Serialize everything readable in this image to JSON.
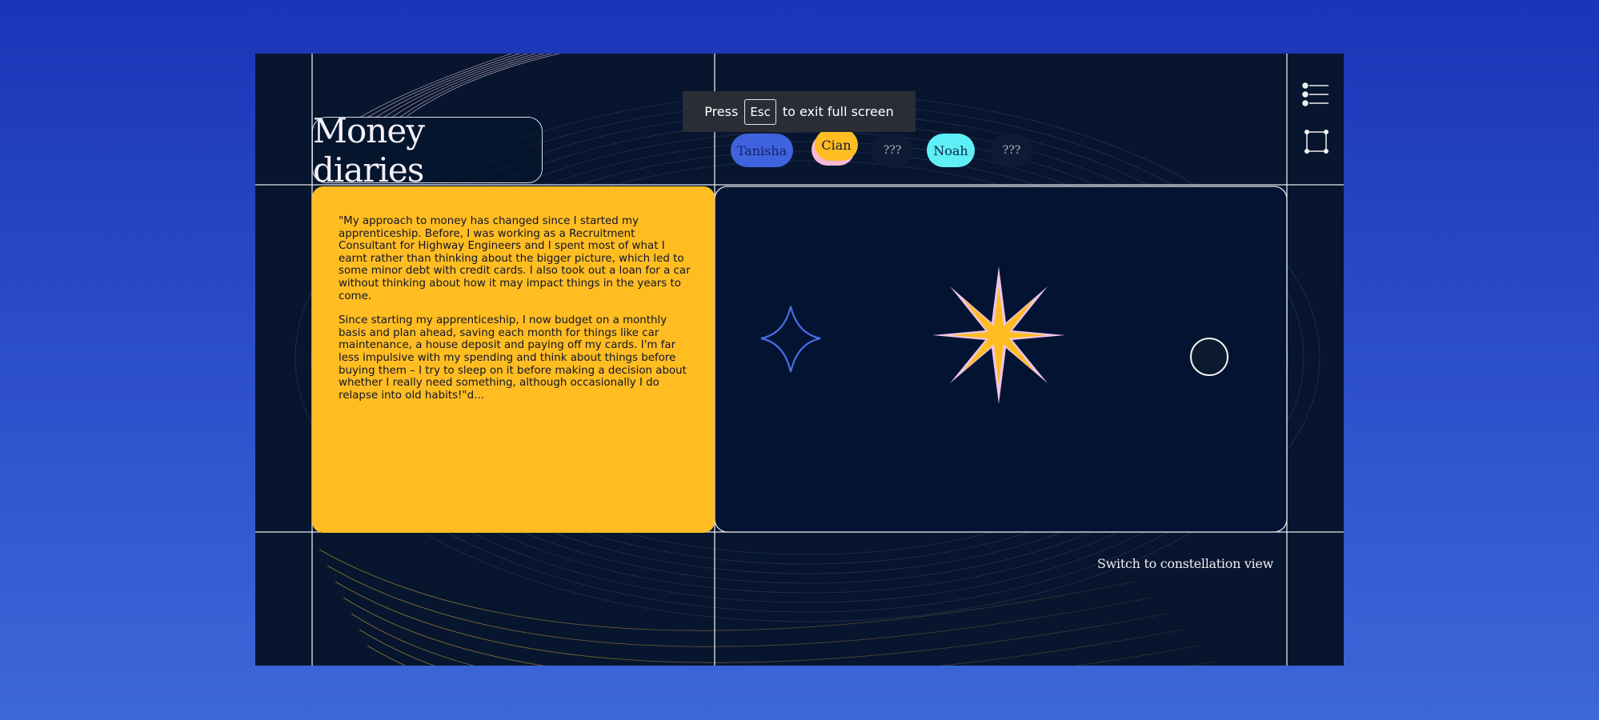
{
  "app": {
    "title": "Money diaries"
  },
  "fullscreen_notice": {
    "prefix": "Press",
    "key": "Esc",
    "suffix": "to exit full screen"
  },
  "people_tabs": [
    {
      "label": "Tanisha",
      "color": "#3f63de"
    },
    {
      "label": "Cian",
      "color": "#ffbd22"
    },
    {
      "label": "???",
      "color": "#0d1b34"
    },
    {
      "label": "Noah",
      "color": "#5ef0f6"
    },
    {
      "label": "???",
      "color": "#0d1b34"
    }
  ],
  "quote": {
    "paragraph_1": "\"My approach to money has changed since I started my apprenticeship. Before, I was working as a Recruitment Consultant for Highway Engineers and I spent most of what I earnt rather than thinking about the bigger picture, which led to some minor debt with credit cards. I also took out a loan for a car without thinking about how it may impact things in the years to come.",
    "paragraph_2": "Since starting my apprenticeship, I now budget on a monthly basis and plan ahead, saving each month for things like car maintenance, a house deposit and paying off my cards. I'm far less impulsive with my spending and think about things before buying them – I try to sleep on it before making a decision about whether I really need something, although occasionally I do relapse into old habits!\"d..."
  },
  "actions": {
    "switch_view": "Switch to constellation view"
  },
  "icons": {
    "menu": "list-menu-icon",
    "frame": "frame-select-icon",
    "star_small": "four-point-star-icon",
    "star_large": "eight-point-star-icon",
    "circle": "circle-button-icon"
  },
  "colors": {
    "background": "#1c34b8",
    "panel": "#07152e",
    "accent_yellow": "#ffbd22",
    "accent_blue": "#3f63de",
    "accent_cyan": "#5ef0f6",
    "accent_pink": "#f4b9d6"
  }
}
